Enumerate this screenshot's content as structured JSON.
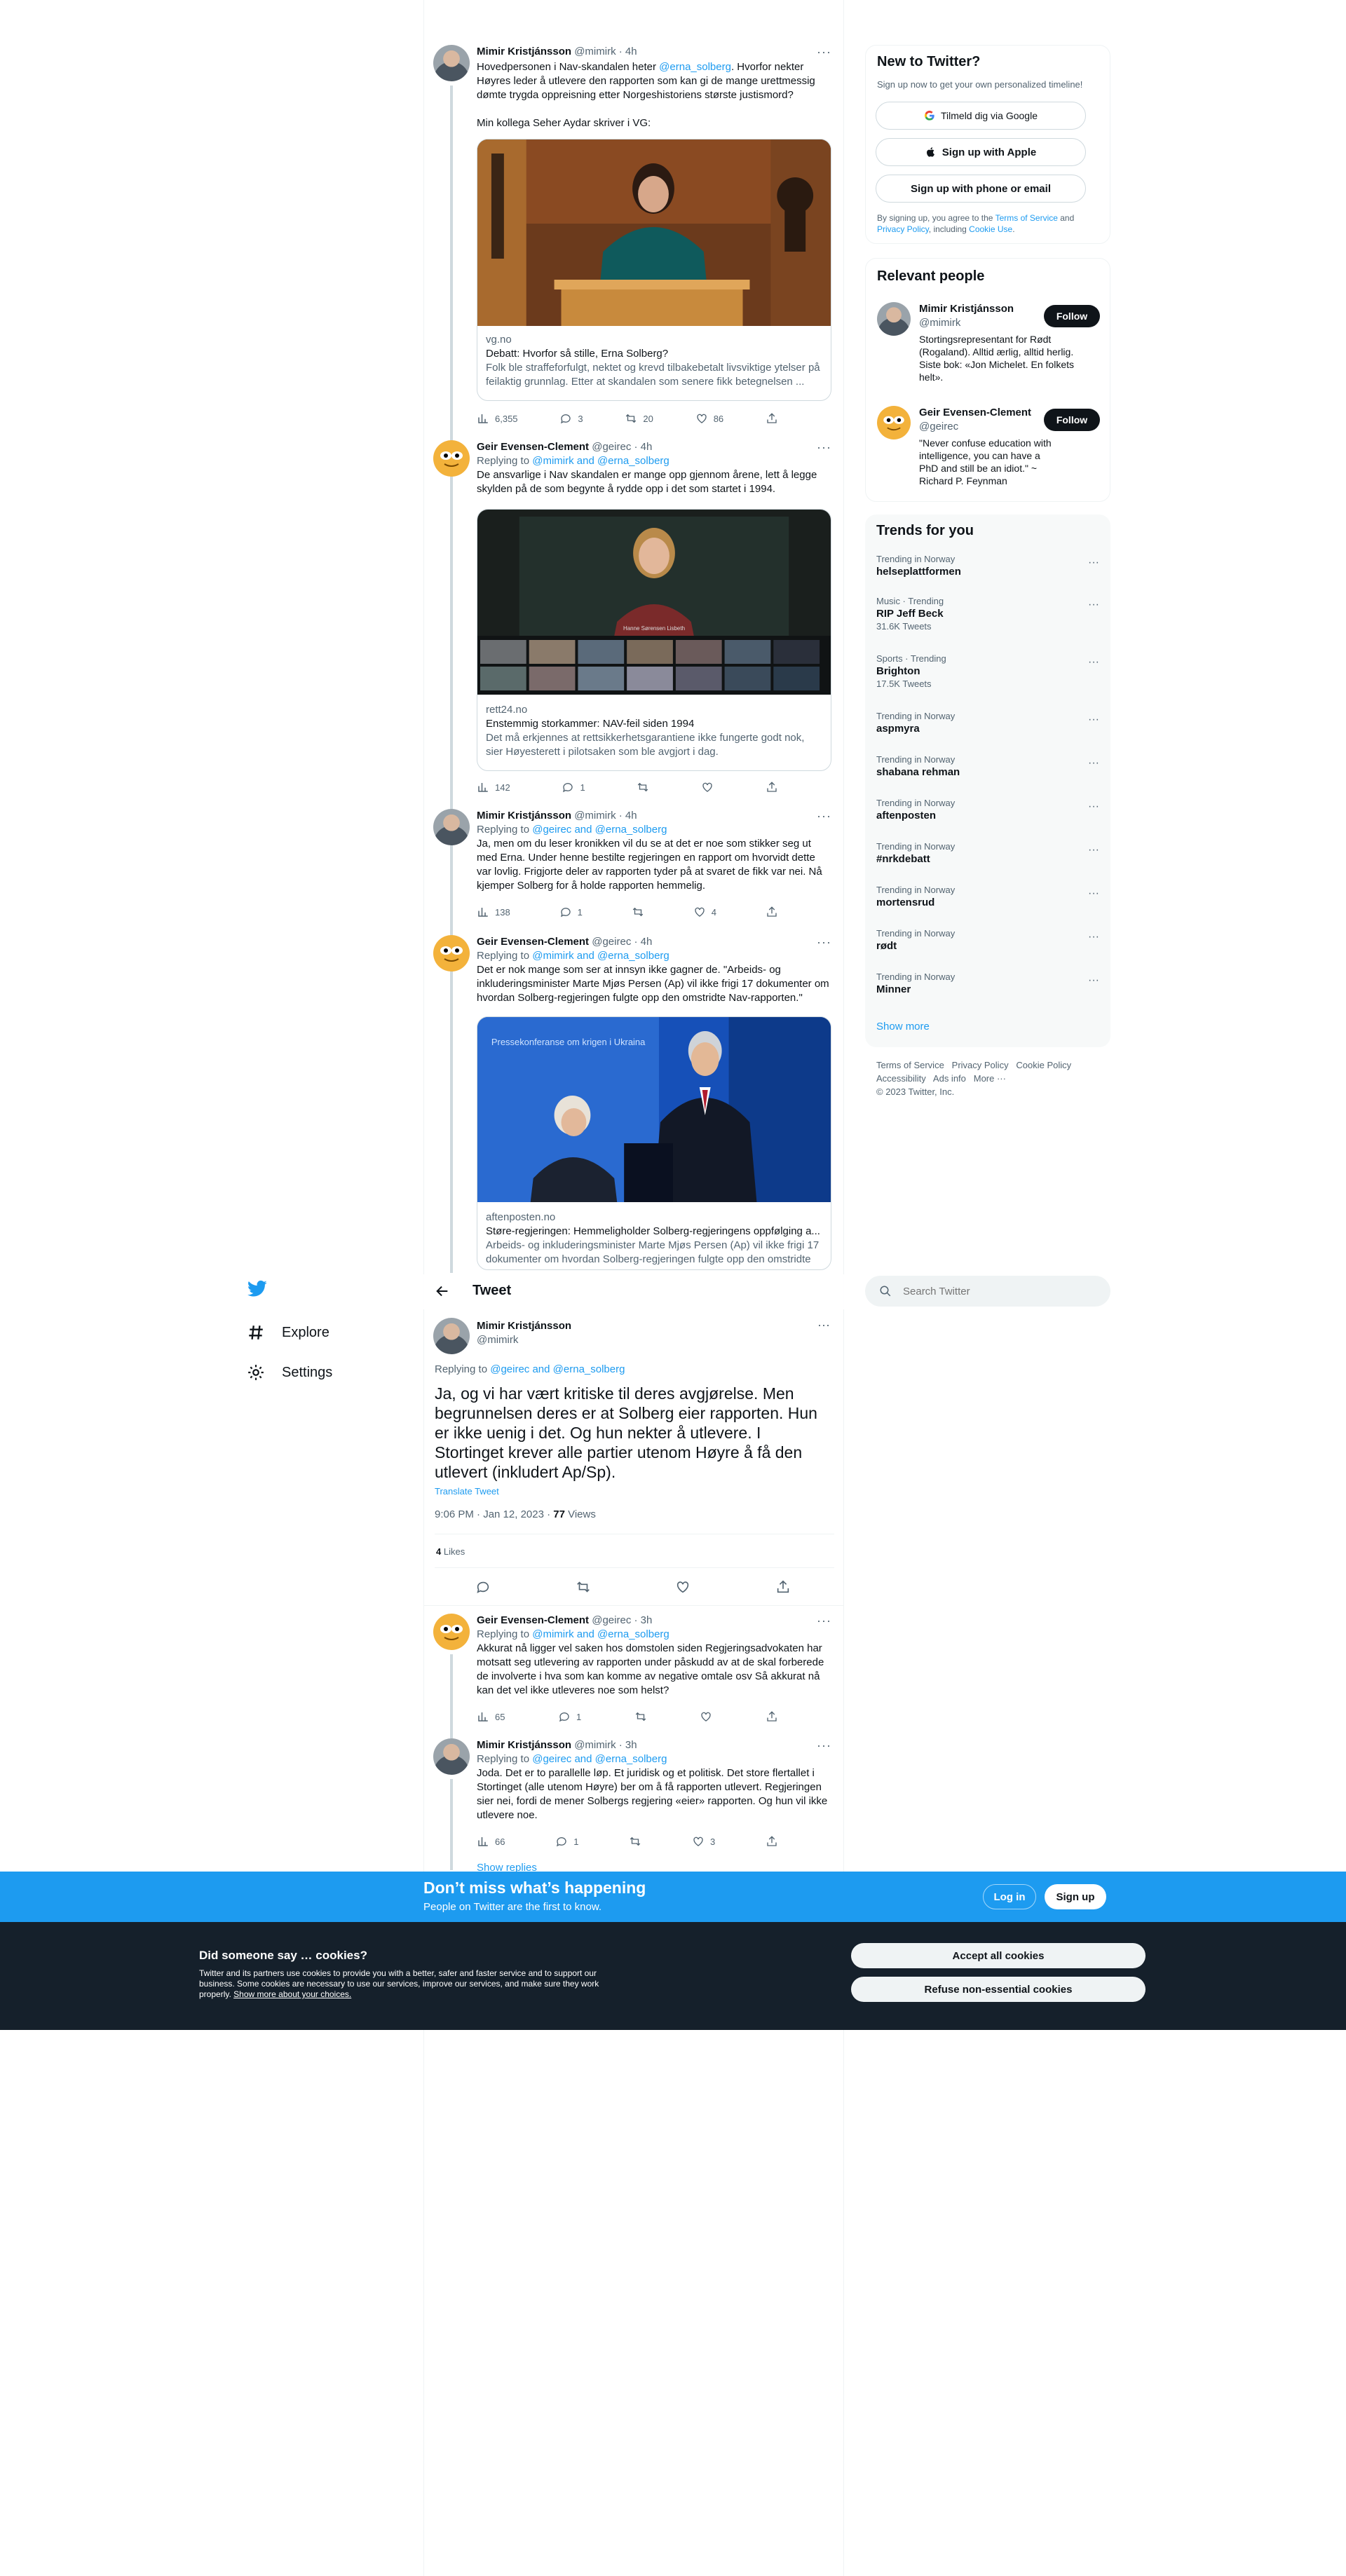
{
  "colors": {
    "accent": "#1d9bf0",
    "text": "#0f1419",
    "muted": "#536471",
    "cookie_bg": "#15202b",
    "banner_bg": "#1d9bf0"
  },
  "tweets": [
    {
      "name": "Mimir Kristjánsson",
      "handle": "@mimirk",
      "time": "· 4h",
      "avatar": "mimir",
      "text_a": "Hovedpersonen i Nav-skandalen heter ",
      "mention": "@erna_solberg",
      "text_b": ". Hvorfor nekter Høyres leder å utlevere den rapporten som kan gi de mange urettmessig dømte trygda oppreisning etter Norgeshistoriens største justismord?",
      "text_c": "Min kollega Seher Aydar skriver i VG:",
      "card": {
        "domain": "vg.no",
        "title": "Debatt: Hvorfor så stille, Erna Solberg?",
        "desc": "Folk ble straffeforfulgt, nektet og krevd tilbakebetalt livsviktige ytelser på feilaktig grunnlag. Etter at skandalen som senere fikk betegnelsen ..."
      },
      "views": "6,355",
      "replies": "3",
      "retweets": "20",
      "likes": "86"
    },
    {
      "name": "Geir Evensen-Clement",
      "handle": "@geirec",
      "time": "· 4h",
      "avatar": "geir",
      "replying_label": "Replying to ",
      "replying_to": "@mimirk and @erna_solberg",
      "text": "De ansvarlige i Nav skandalen er mange opp gjennom årene, lett å legge skylden på de som begynte å rydde opp i det som startet i 1994.",
      "card": {
        "domain": "rett24.no",
        "title": "Enstemmig storkammer: NAV-feil siden 1994",
        "desc": "Det må erkjennes at rettsikkerhetsgarantiene ikke fungerte godt nok, sier Høyesterett i pilotsaken som ble avgjort i dag.",
        "overlay": "Hanne Sørensen Lisbeth"
      },
      "views": "142",
      "replies": "1",
      "retweets": "",
      "likes": ""
    },
    {
      "name": "Mimir Kristjánsson",
      "handle": "@mimirk",
      "time": "· 4h",
      "avatar": "mimir",
      "replying_label": "Replying to ",
      "replying_to": "@geirec and @erna_solberg",
      "text": "Ja, men om du leser kronikken vil du se at det er noe som stikker seg ut med Erna. Under henne bestilte regjeringen en rapport om hvorvidt dette var lovlig. Frigjorte deler av rapporten tyder på at svaret de fikk var nei. Nå kjemper Solberg for å holde rapporten hemmelig.",
      "views": "138",
      "replies": "1",
      "retweets": "",
      "likes": "4"
    },
    {
      "name": "Geir Evensen-Clement",
      "handle": "@geirec",
      "time": "· 4h",
      "avatar": "geir",
      "replying_label": "Replying to ",
      "replying_to": "@mimirk and @erna_solberg",
      "text": "Det er nok mange som ser at innsyn ikke gagner de. \"Arbeids- og inkluderingsminister Marte Mjøs Persen (Ap) vil ikke frigi 17 dokumenter om hvordan Solberg-regjeringen fulgte opp den omstridte Nav-rapporten.\"",
      "card": {
        "domain": "aftenposten.no",
        "title": "Støre-regjeringen: Hemmeligholder Solberg-regjeringens oppfølging a...",
        "desc": "Arbeids- og inkluderingsminister Marte Mjøs Persen (Ap) vil ikke frigi 17 dokumenter om hvordan Solberg-regjeringen fulgte opp den omstridte ...",
        "overlay": "Pressekonferanse om krigen i Ukraina"
      }
    }
  ],
  "main_tweet": {
    "header": "Tweet",
    "name": "Mimir Kristjánsson",
    "handle": "@mimirk",
    "replying_label": "Replying to ",
    "replying_to": "@geirec and @erna_solberg",
    "text": "Ja, og vi har vært kritiske til deres avgjørelse. Men begrunnelsen deres er at Solberg eier rapporten. Hun er ikke uenig i det. Og hun nekter å utlevere. I Stortinget krever alle partier utenom Høyre å få den utlevert (inkludert Ap/Sp).",
    "translate": "Translate Tweet",
    "timestamp": "9:06 PM · Jan 12, 2023 · ",
    "views_count": "77",
    "views_label": " Views",
    "likes_count": "4",
    "likes_label": " Likes"
  },
  "replies": [
    {
      "name": "Geir Evensen-Clement",
      "handle": "@geirec",
      "time": "· 3h",
      "replying_label": "Replying to ",
      "replying_to": "@mimirk and @erna_solberg",
      "text": "Akkurat nå ligger vel saken hos domstolen siden Regjeringsadvokaten har motsatt seg utlevering av rapporten under påskudd av at de skal forberede de involverte i hva som kan komme av negative omtale osv Så akkurat nå kan det vel ikke utleveres noe som helst?",
      "views": "65",
      "replies": "1",
      "retweets": "",
      "likes": ""
    },
    {
      "name": "Mimir Kristjánsson",
      "handle": "@mimirk",
      "time": "· 3h",
      "replying_label": "Replying to ",
      "replying_to": "@geirec and @erna_solberg",
      "text": "Joda. Det er to parallelle løp. Et juridisk og et politisk. Det store flertallet i Stortinget (alle utenom Høyre) ber om å få rapporten utlevert. Regjeringen sier nei, fordi de mener Solbergs regjering «eier» rapporten. Og hun vil ikke utlevere noe.",
      "views": "66",
      "replies": "1",
      "retweets": "",
      "likes": "3"
    }
  ],
  "show_replies": "Show replies",
  "nav": {
    "explore": "Explore",
    "settings": "Settings"
  },
  "search": {
    "placeholder": "Search Twitter"
  },
  "signup": {
    "title": "New to Twitter?",
    "subtitle": "Sign up now to get your own personalized timeline!",
    "google": "Tilmeld dig via Google",
    "apple": "Sign up with Apple",
    "phone": "Sign up with phone or email",
    "legal_a": "By signing up, you agree to the ",
    "terms": "Terms of Service",
    "legal_b": " and ",
    "privacy": "Privacy Policy",
    "legal_c": ", including ",
    "cookie": "Cookie Use",
    "legal_d": "."
  },
  "relevant": {
    "title": "Relevant people",
    "people": [
      {
        "name": "Mimir Kristjánsson",
        "handle": "@mimirk",
        "bio": "Stortingsrepresentant for Rødt (Rogaland). Alltid ærlig, alltid herlig. Siste bok: «Jon Michelet. En folkets helt».",
        "follow": "Follow"
      },
      {
        "name": "Geir Evensen-Clement",
        "handle": "@geirec",
        "bio": "\"Never confuse education with intelligence, you can have a PhD and still be an idiot.\" ~ Richard P. Feynman",
        "follow": "Follow"
      }
    ]
  },
  "trends": {
    "title": "Trends for you",
    "items": [
      {
        "cat": "Trending in Norway",
        "name": "helseplattformen",
        "count": ""
      },
      {
        "cat": "Music · Trending",
        "name": "RIP Jeff Beck",
        "count": "31.6K Tweets"
      },
      {
        "cat": "Sports · Trending",
        "name": "Brighton",
        "count": "17.5K Tweets"
      },
      {
        "cat": "Trending in Norway",
        "name": "aspmyra",
        "count": ""
      },
      {
        "cat": "Trending in Norway",
        "name": "shabana rehman",
        "count": ""
      },
      {
        "cat": "Trending in Norway",
        "name": "aftenposten",
        "count": ""
      },
      {
        "cat": "Trending in Norway",
        "name": "#nrkdebatt",
        "count": ""
      },
      {
        "cat": "Trending in Norway",
        "name": "mortensrud",
        "count": ""
      },
      {
        "cat": "Trending in Norway",
        "name": "rødt",
        "count": ""
      },
      {
        "cat": "Trending in Norway",
        "name": "Minner",
        "count": ""
      }
    ],
    "show_more": "Show more"
  },
  "footer": {
    "terms": "Terms of Service",
    "privacy": "Privacy Policy",
    "cookie": "Cookie Policy",
    "accessibility": "Accessibility",
    "ads": "Ads info",
    "more": "More ···",
    "copyright": "© 2023 Twitter, Inc."
  },
  "banner": {
    "title": "Don’t miss what’s happening",
    "subtitle": "People on Twitter are the first to know.",
    "login": "Log in",
    "signup": "Sign up"
  },
  "cookies": {
    "title": "Did someone say … cookies?",
    "text": "Twitter and its partners use cookies to provide you with a better, safer and faster service and to support our business. Some cookies are necessary to use our services, improve our services, and make sure they work properly. ",
    "link": "Show more about your choices.",
    "accept": "Accept all cookies",
    "refuse": "Refuse non-essential cookies"
  }
}
